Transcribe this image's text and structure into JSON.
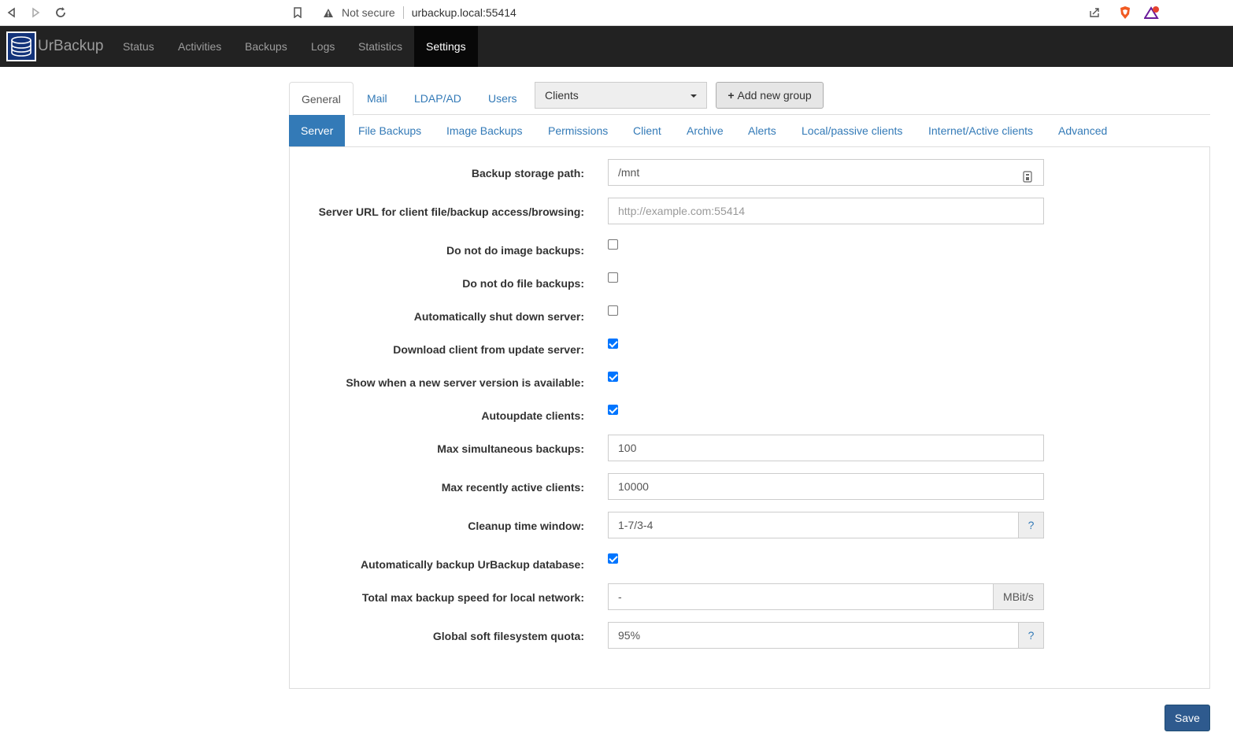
{
  "browser": {
    "security_label": "Not secure",
    "url": "urbackup.local:55414"
  },
  "navbar": {
    "brand": "UrBackup",
    "items": [
      {
        "label": "Status"
      },
      {
        "label": "Activities"
      },
      {
        "label": "Backups"
      },
      {
        "label": "Logs"
      },
      {
        "label": "Statistics"
      },
      {
        "label": "Settings"
      }
    ],
    "active": "Settings"
  },
  "top_tabs": {
    "items": [
      {
        "label": "General"
      },
      {
        "label": "Mail"
      },
      {
        "label": "LDAP/AD"
      },
      {
        "label": "Users"
      }
    ],
    "group_select_value": "Clients",
    "add_group_label": "Add new group"
  },
  "sub_tabs": {
    "items": [
      {
        "label": "Server"
      },
      {
        "label": "File Backups"
      },
      {
        "label": "Image Backups"
      },
      {
        "label": "Permissions"
      },
      {
        "label": "Client"
      },
      {
        "label": "Archive"
      },
      {
        "label": "Alerts"
      },
      {
        "label": "Local/passive clients"
      },
      {
        "label": "Internet/Active clients"
      },
      {
        "label": "Advanced"
      }
    ]
  },
  "settings": {
    "backup_storage_path": {
      "label": "Backup storage path:",
      "value": "/mnt"
    },
    "server_url": {
      "label": "Server URL for client file/backup access/browsing:",
      "placeholder": "http://example.com:55414"
    },
    "no_image_backups": {
      "label": "Do not do image backups:",
      "checked": false
    },
    "no_file_backups": {
      "label": "Do not do file backups:",
      "checked": false
    },
    "auto_shutdown": {
      "label": "Automatically shut down server:",
      "checked": false
    },
    "download_client": {
      "label": "Download client from update server:",
      "checked": true
    },
    "show_new_version": {
      "label": "Show when a new server version is available:",
      "checked": true
    },
    "autoupdate_clients": {
      "label": "Autoupdate clients:",
      "checked": true
    },
    "max_simultaneous_backups": {
      "label": "Max simultaneous backups:",
      "value": "100"
    },
    "max_recently_active_clients": {
      "label": "Max recently active clients:",
      "value": "10000"
    },
    "cleanup_time_window": {
      "label": "Cleanup time window:",
      "value": "1-7/3-4",
      "help": "?"
    },
    "auto_backup_db": {
      "label": "Automatically backup UrBackup database:",
      "checked": true
    },
    "max_backup_speed_local": {
      "label": "Total max backup speed for local network:",
      "value": "-",
      "unit": "MBit/s"
    },
    "global_soft_quota": {
      "label": "Global soft filesystem quota:",
      "value": "95%",
      "help": "?"
    }
  },
  "save_label": "Save"
}
